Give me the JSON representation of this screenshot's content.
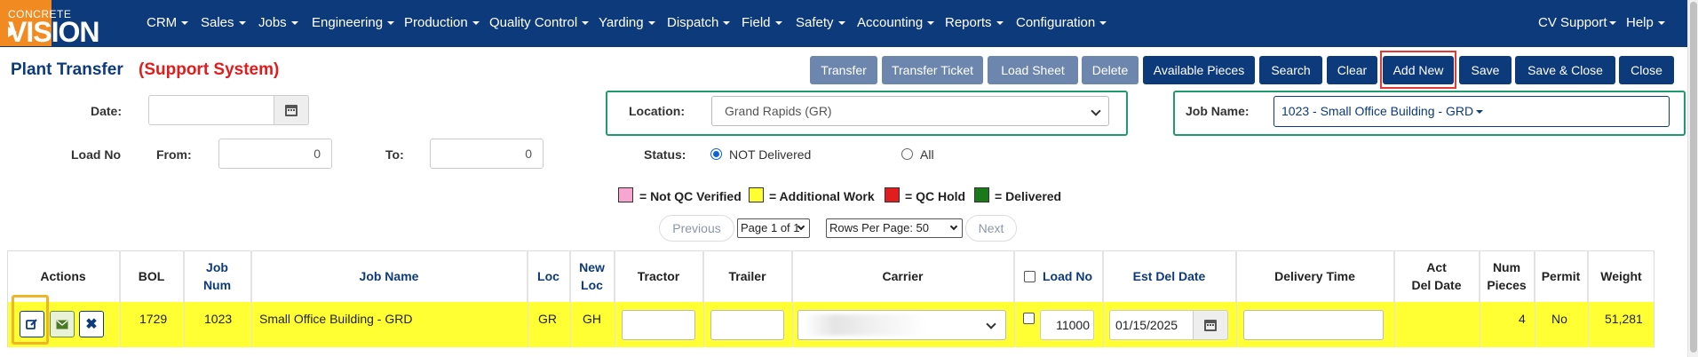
{
  "nav": {
    "brand_top": "CONCRETE",
    "brand_main": "VISION",
    "menu": [
      "CRM",
      "Sales",
      "Jobs",
      "Engineering",
      "Production",
      "Quality Control",
      "Yarding",
      "Dispatch",
      "Field",
      "Safety",
      "Accounting",
      "Reports",
      "Configuration"
    ],
    "right": [
      "CV Support",
      "Help"
    ]
  },
  "page": {
    "title": "Plant Transfer",
    "subtitle": "(Support System)"
  },
  "toolbar": {
    "buttons": [
      "Transfer",
      "Transfer Ticket",
      "Load Sheet",
      "Delete",
      "Available Pieces",
      "Search",
      "Clear",
      "Add New",
      "Save",
      "Save & Close",
      "Close"
    ]
  },
  "filters": {
    "date_label": "Date:",
    "date_value": "",
    "load_no_label": "Load No",
    "from_label": "From:",
    "from_value": "0",
    "to_label": "To:",
    "to_value": "0",
    "location_label": "Location:",
    "location_value": "Grand Rapids (GR)",
    "status_label": "Status:",
    "status_options": [
      "NOT Delivered",
      "All"
    ],
    "status_selected": "NOT Delivered",
    "job_name_label": "Job Name:",
    "job_name_value": "1023 - Small Office Building - GRD"
  },
  "legend": [
    {
      "label": "= Not QC Verified",
      "color": "#f6a6cf"
    },
    {
      "label": "= Additional Work",
      "color": "#ffff33"
    },
    {
      "label": "= QC Hold",
      "color": "#e11d1d"
    },
    {
      "label": "= Delivered",
      "color": "#1a7a1a"
    }
  ],
  "pager": {
    "previous": "Previous",
    "page": "Page 1 of 1",
    "rows_per_page": "Rows Per Page: 50",
    "next": "Next"
  },
  "table": {
    "columns": [
      {
        "line1": "Actions",
        "line2": ""
      },
      {
        "line1": "BOL",
        "line2": ""
      },
      {
        "line1": "Job",
        "line2": "Num"
      },
      {
        "line1": "Job Name",
        "line2": ""
      },
      {
        "line1": "Loc",
        "line2": ""
      },
      {
        "line1": "New",
        "line2": "Loc"
      },
      {
        "line1": "Tractor",
        "line2": ""
      },
      {
        "line1": "Trailer",
        "line2": ""
      },
      {
        "line1": "Carrier",
        "line2": ""
      },
      {
        "line1": "Load No",
        "line2": ""
      },
      {
        "line1": "Est Del Date",
        "line2": ""
      },
      {
        "line1": "Delivery Time",
        "line2": ""
      },
      {
        "line1": "Act",
        "line2": "Del Date"
      },
      {
        "line1": "Num",
        "line2": "Pieces"
      },
      {
        "line1": "Permit",
        "line2": ""
      },
      {
        "line1": "Weight",
        "line2": ""
      }
    ],
    "rows": [
      {
        "bol": "1729",
        "job_num": "1023",
        "job_name": "Small Office Building - GRD",
        "loc": "GR",
        "new_loc": "GH",
        "tractor": "",
        "trailer": "",
        "load_no": "11000",
        "est_del_date": "01/15/2025",
        "delivery_time": "",
        "act_del_date": "",
        "num_pieces": "4",
        "permit": "No",
        "weight": "51,281",
        "row_color": "#ffff33"
      }
    ]
  },
  "icons": [
    "caret-down-icon",
    "calendar-icon",
    "edit-icon",
    "email-icon",
    "close-icon",
    "chevron-down-icon"
  ]
}
